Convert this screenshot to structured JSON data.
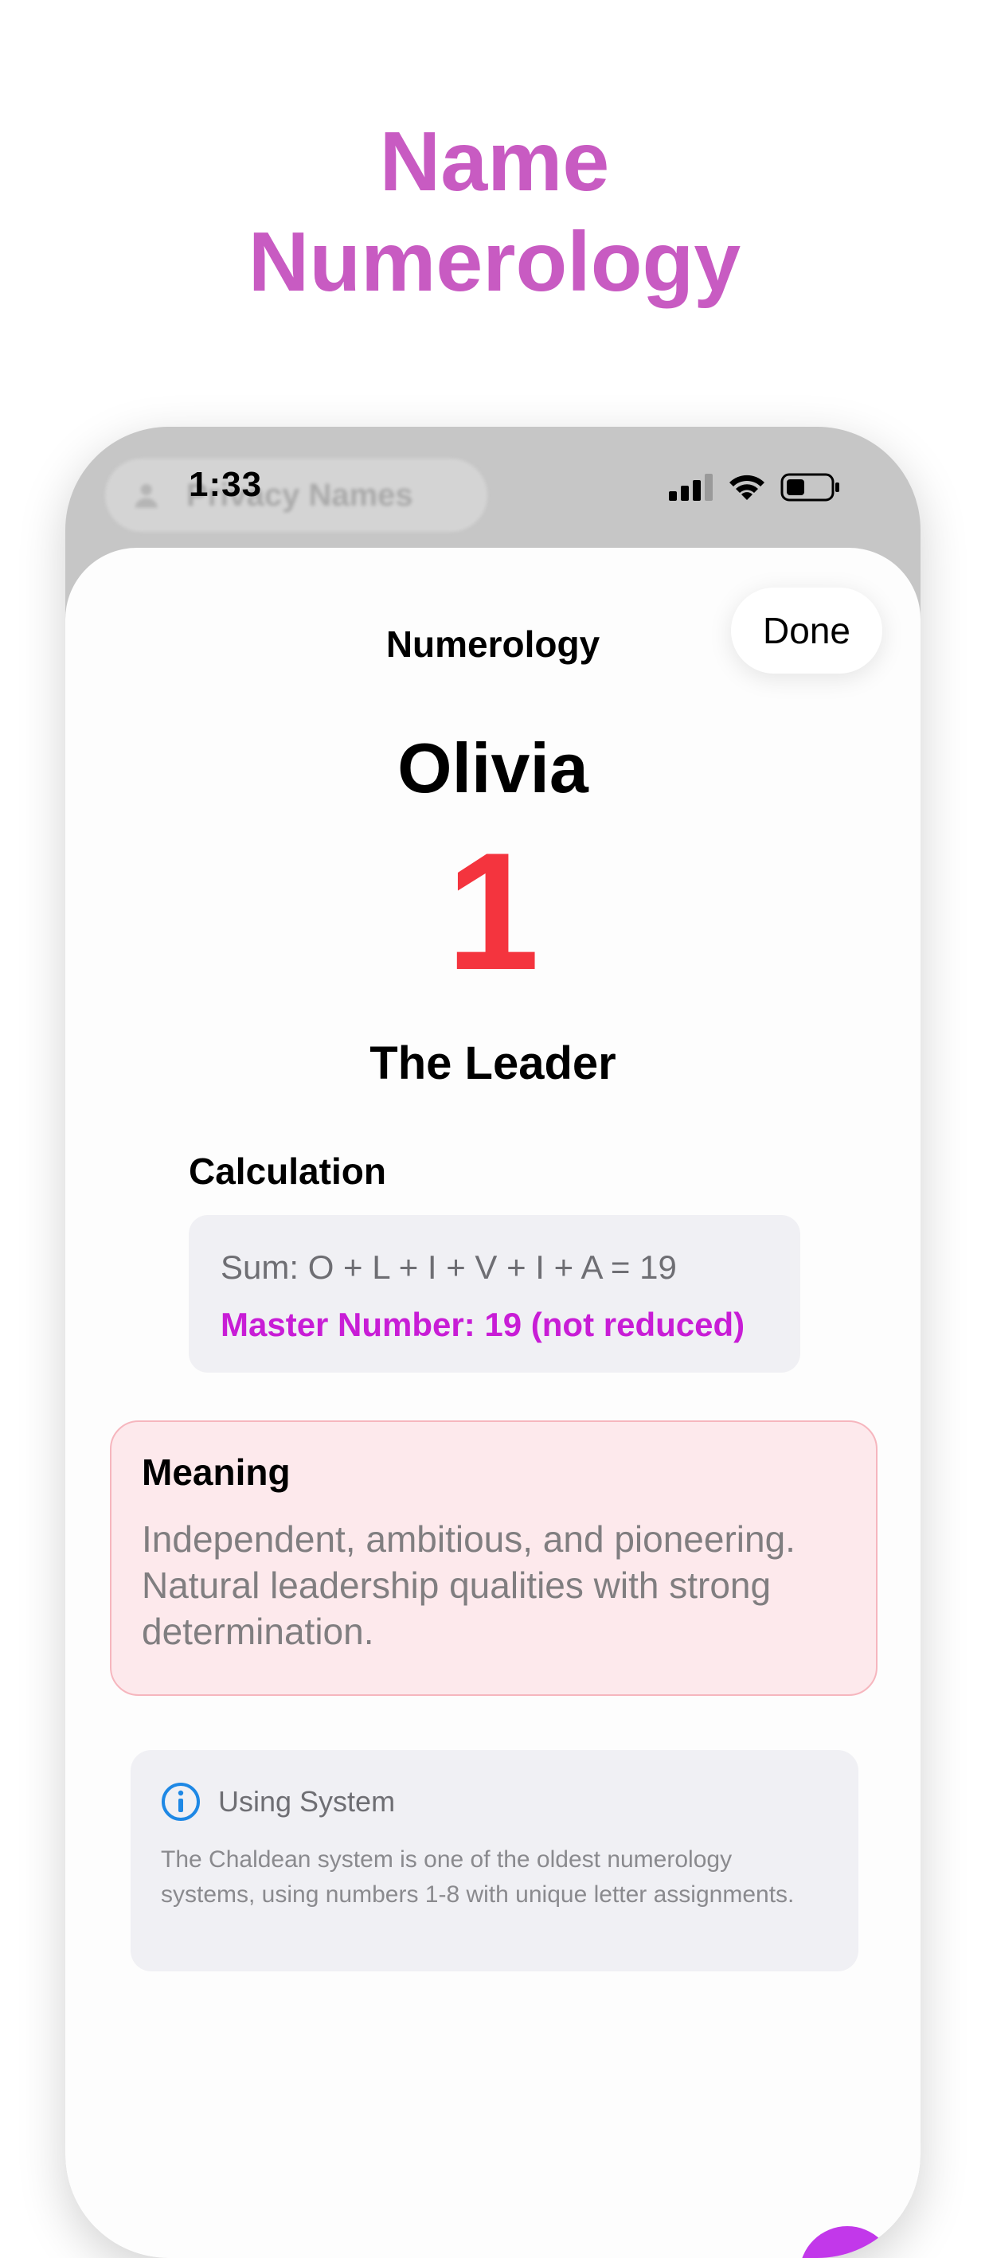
{
  "headline": {
    "line1": "Name",
    "line2": "Numerology"
  },
  "status_bar": {
    "time": "1:33",
    "signal_icon": "cellular-signal-icon",
    "wifi_icon": "wifi-icon",
    "battery_icon": "battery-icon"
  },
  "background_app": {
    "pill_label": "Privacy Names",
    "pill_icon": "person-icon"
  },
  "sheet": {
    "title": "Numerology",
    "done_label": "Done",
    "name": "Olivia",
    "number": "1",
    "archetype": "The Leader",
    "calculation": {
      "heading": "Calculation",
      "sum": "Sum: O + L + I + V + I + A = 19",
      "master": "Master Number: 19 (not reduced)"
    },
    "meaning": {
      "title": "Meaning",
      "text": "Independent, ambitious, and pioneering. Natural leadership qualities with strong determination."
    },
    "info": {
      "icon": "info-icon",
      "heading": "Using  System",
      "body": "The Chaldean system is one of the oldest numerology systems, using numbers 1-8 with unique letter assignments."
    }
  },
  "colors": {
    "headline": "#C85BC2",
    "number": "#F4343E",
    "master": "#C81DD6",
    "meaning_bg": "#FDE9EC",
    "info_icon": "#1E88E5",
    "fab": "#C238EA"
  }
}
